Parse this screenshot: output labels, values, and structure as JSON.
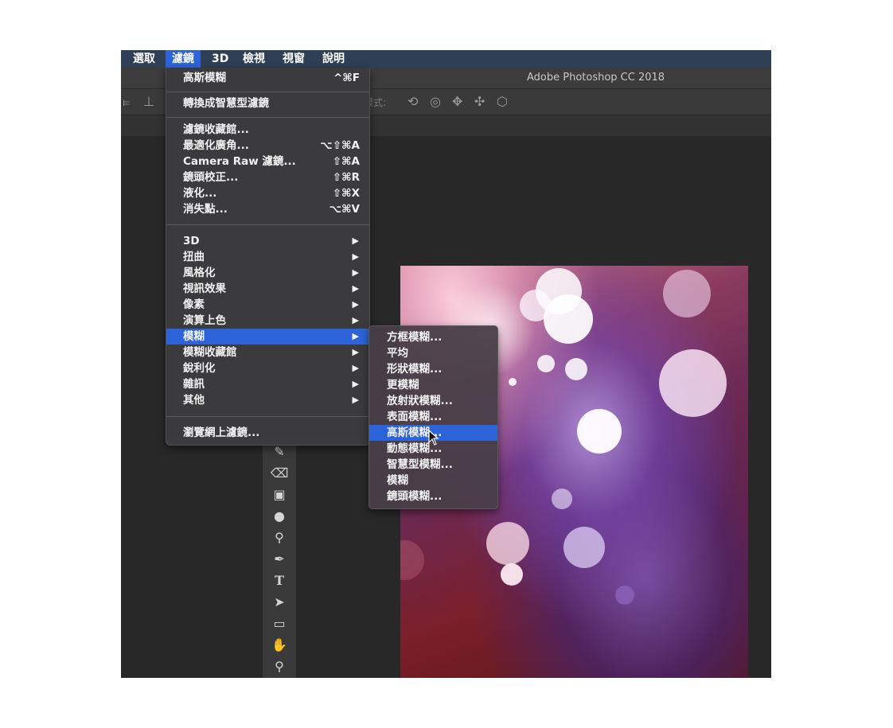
{
  "menubar": {
    "items": [
      {
        "label": "選取",
        "active": false
      },
      {
        "label": "濾鏡",
        "active": true
      },
      {
        "label": "3D",
        "active": false
      },
      {
        "label": "檢視",
        "active": false
      },
      {
        "label": "視窗",
        "active": false
      },
      {
        "label": "說明",
        "active": false
      }
    ]
  },
  "window": {
    "title": "Adobe Photoshop CC 2018"
  },
  "options_bar": {
    "mode_label": "模式:",
    "icons": [
      "align-icon",
      "align-center-icon",
      "3d-rotate-icon",
      "3d-roll-icon",
      "3d-pan-icon",
      "3d-slide-icon",
      "3d-scale-icon"
    ]
  },
  "filter_menu": {
    "last_filter": {
      "label": "高斯模糊",
      "shortcut": "^⌘F"
    },
    "convert_smart": {
      "label": "轉換成智慧型濾鏡"
    },
    "group1": [
      {
        "label": "濾鏡收藏館...",
        "shortcut": ""
      },
      {
        "label": "最適化廣角...",
        "shortcut": "⌥⇧⌘A"
      },
      {
        "label": "Camera Raw 濾鏡...",
        "shortcut": "⇧⌘A"
      },
      {
        "label": "鏡頭校正...",
        "shortcut": "⇧⌘R"
      },
      {
        "label": "液化...",
        "shortcut": "⇧⌘X"
      },
      {
        "label": "消失點...",
        "shortcut": "⌥⌘V"
      }
    ],
    "submenus": [
      {
        "label": "3D"
      },
      {
        "label": "扭曲"
      },
      {
        "label": "風格化"
      },
      {
        "label": "視訊效果"
      },
      {
        "label": "像素"
      },
      {
        "label": "演算上色"
      },
      {
        "label": "模糊",
        "highlighted": true
      },
      {
        "label": "模糊收藏館"
      },
      {
        "label": "銳利化"
      },
      {
        "label": "雜訊"
      },
      {
        "label": "其他"
      }
    ],
    "browse_online": {
      "label": "瀏覽網上濾鏡..."
    }
  },
  "blur_submenu": {
    "items": [
      {
        "label": "方框模糊..."
      },
      {
        "label": "平均"
      },
      {
        "label": "形狀模糊..."
      },
      {
        "label": "更模糊"
      },
      {
        "label": "放射狀模糊..."
      },
      {
        "label": "表面模糊..."
      },
      {
        "label": "高斯模糊...",
        "highlighted": true
      },
      {
        "label": "動態模糊..."
      },
      {
        "label": "智慧型模糊..."
      },
      {
        "label": "模糊"
      },
      {
        "label": "鏡頭模糊..."
      }
    ]
  },
  "toolbar": {
    "tools": [
      {
        "name": "history-brush-icon",
        "glyph": "✎"
      },
      {
        "name": "eraser-icon",
        "glyph": "⌫"
      },
      {
        "name": "gradient-icon",
        "glyph": "▣"
      },
      {
        "name": "blur-drop-icon",
        "glyph": "●"
      },
      {
        "name": "dodge-icon",
        "glyph": "⚲"
      },
      {
        "name": "pen-icon",
        "glyph": "✒"
      },
      {
        "name": "type-icon",
        "glyph": "T"
      },
      {
        "name": "path-select-icon",
        "glyph": "➤"
      },
      {
        "name": "rectangle-icon",
        "glyph": "▭"
      },
      {
        "name": "hand-icon",
        "glyph": "✋"
      },
      {
        "name": "zoom-icon",
        "glyph": "🔍"
      }
    ]
  },
  "colors": {
    "menu_highlight": "#2d63d8",
    "menubar_bg": "#2f3f56",
    "app_bg": "#282828"
  }
}
